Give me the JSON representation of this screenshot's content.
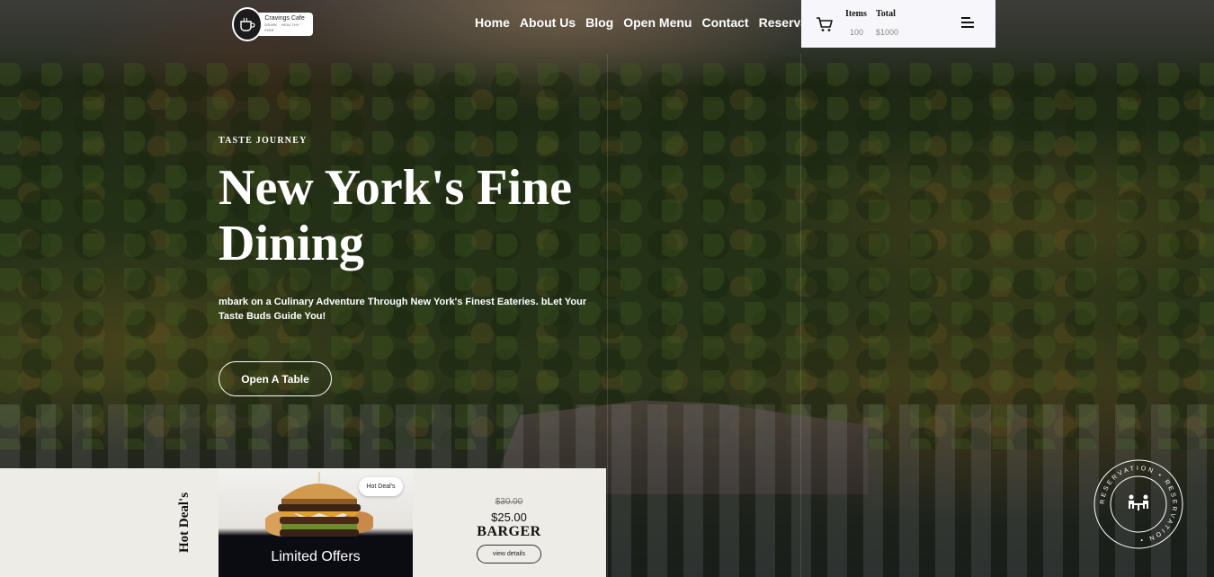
{
  "brand": {
    "name": "Cravings Cafe",
    "tagline": "DRINK · HEALTHY · FIRE"
  },
  "nav": {
    "items": [
      "Home",
      "About Us",
      "Blog",
      "Open Menu",
      "Contact",
      "Reservation"
    ]
  },
  "cart": {
    "items_label": "Items",
    "items_value": "100",
    "total_label": "Total",
    "total_value": "$1000"
  },
  "hero": {
    "eyebrow": "Taste Journey",
    "title": "New York's Fine Dining",
    "description": "mbark on a Culinary Adventure Through New York's Finest Eateries. bLet Your Taste Buds Guide You!",
    "cta_label": "Open A Table"
  },
  "deal": {
    "section_label": "Hot Deal's",
    "badge": "Hot Deal's",
    "offer_label": "Limited Offers",
    "old_price": "$30.00",
    "new_price": "$25.00",
    "name": "BARGER",
    "button_label": "view details"
  },
  "reservation_badge": {
    "text": "RESERVATION • RESERVATION •"
  },
  "colors": {
    "deal_background": "#eeece6",
    "cart_background": "#f7f7fb",
    "offer_background": "#0b0b12"
  },
  "icons": {
    "cart": "shopping-cart-icon",
    "menu": "hamburger-menu-icon",
    "logo": "coffee-cup-icon",
    "reservation": "dining-table-icon"
  }
}
